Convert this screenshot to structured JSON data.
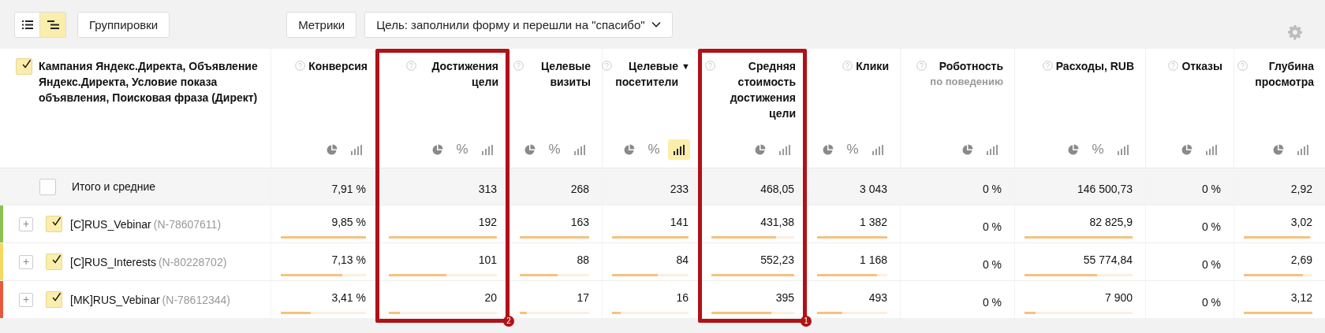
{
  "toolbar": {
    "view_toggle": [
      {
        "kind": "list",
        "selected": false
      },
      {
        "kind": "tree",
        "selected": true
      }
    ],
    "groupings_button": "Группировки",
    "metrics_button": "Метрики",
    "goal_dropdown": "Цель: заполнили форму и перешли на \"спасибо\""
  },
  "dimension_header": {
    "checked": true,
    "title": "Кампания Яндекс.Директа, Объявление Яндекс.Директа, Условие показа объявления, Поисковая фраза (Директ)"
  },
  "columns": [
    {
      "title": "Конверсия",
      "highlighted": false,
      "buttons": [
        {
          "kind": "pie",
          "selected": false
        },
        {
          "kind": "bars",
          "selected": false
        }
      ]
    },
    {
      "title": "Достижения цели",
      "highlighted": true,
      "badge": "2",
      "buttons": [
        {
          "kind": "pie",
          "selected": false
        },
        {
          "kind": "percent",
          "label": "%",
          "selected": false
        },
        {
          "kind": "bars",
          "selected": false
        }
      ]
    },
    {
      "title": "Целевые визиты",
      "highlighted": false,
      "buttons": [
        {
          "kind": "pie",
          "selected": false
        },
        {
          "kind": "percent",
          "label": "%",
          "selected": false
        },
        {
          "kind": "bars",
          "selected": false
        }
      ]
    },
    {
      "title": "Целевые посетители",
      "sort": "▼",
      "highlighted": false,
      "buttons": [
        {
          "kind": "pie",
          "selected": false
        },
        {
          "kind": "percent",
          "label": "%",
          "selected": false
        },
        {
          "kind": "bars",
          "selected": true
        }
      ]
    },
    {
      "title": "Средняя стоимость достижения цели",
      "highlighted": true,
      "badge": "1",
      "buttons": [
        {
          "kind": "pie",
          "selected": false
        },
        {
          "kind": "bars",
          "selected": false
        }
      ]
    },
    {
      "title": "Клики",
      "highlighted": false,
      "buttons": [
        {
          "kind": "pie",
          "selected": false
        },
        {
          "kind": "percent",
          "label": "%",
          "selected": false
        },
        {
          "kind": "bars",
          "selected": false
        }
      ]
    },
    {
      "title": "Роботность",
      "subtitle": "по поведению",
      "highlighted": false,
      "buttons": [
        {
          "kind": "pie",
          "selected": false
        },
        {
          "kind": "bars",
          "selected": false
        }
      ]
    },
    {
      "title": "Расходы, RUB",
      "highlighted": false,
      "buttons": [
        {
          "kind": "pie",
          "selected": false
        },
        {
          "kind": "percent",
          "label": "%",
          "selected": false
        },
        {
          "kind": "bars",
          "selected": false
        }
      ]
    },
    {
      "title": "Отказы",
      "highlighted": false,
      "buttons": [
        {
          "kind": "pie",
          "selected": false
        },
        {
          "kind": "bars",
          "selected": false
        }
      ]
    },
    {
      "title": "Глубина просмотра",
      "highlighted": false,
      "buttons": [
        {
          "kind": "pie",
          "selected": false
        },
        {
          "kind": "bars",
          "selected": false
        }
      ]
    }
  ],
  "rows": [
    {
      "kind": "total",
      "checked": false,
      "name": "Итого и средние",
      "cells": [
        {
          "value": "7,91 %"
        },
        {
          "value": "313"
        },
        {
          "value": "268"
        },
        {
          "value": "233"
        },
        {
          "value": "468,05"
        },
        {
          "value": "3 043"
        },
        {
          "value": "0 %"
        },
        {
          "value": "146 500,73"
        },
        {
          "value": "0 %"
        },
        {
          "value": "2,92"
        }
      ]
    },
    {
      "kind": "item",
      "color": "#8cc152",
      "expand": "+",
      "checked": true,
      "name": "[C]RUS_Vebinar",
      "id": "(N-78607611)",
      "cells": [
        {
          "value": "9,85 %",
          "level": 1
        },
        {
          "value": "192",
          "level": 1
        },
        {
          "value": "163",
          "level": 1
        },
        {
          "value": "141",
          "level": 1
        },
        {
          "value": "431,38",
          "level": 0.78
        },
        {
          "value": "1 382",
          "level": 1
        },
        {
          "value": "0 %"
        },
        {
          "value": "82 825,9",
          "level": 1
        },
        {
          "value": "0 %"
        },
        {
          "value": "3,02",
          "level": 0.97
        }
      ]
    },
    {
      "kind": "item",
      "color": "#f6d860",
      "expand": "+",
      "checked": true,
      "name": "[C]RUS_Interests",
      "id": "(N-80228702)",
      "cells": [
        {
          "value": "7,13 %",
          "level": 0.72
        },
        {
          "value": "101",
          "level": 0.53
        },
        {
          "value": "88",
          "level": 0.54
        },
        {
          "value": "84",
          "level": 0.6
        },
        {
          "value": "552,23",
          "level": 1
        },
        {
          "value": "1 168",
          "level": 0.85
        },
        {
          "value": "0 %"
        },
        {
          "value": "55 774,84",
          "level": 0.67
        },
        {
          "value": "0 %"
        },
        {
          "value": "2,69",
          "level": 0.86
        }
      ]
    },
    {
      "kind": "item",
      "color": "#e9573f",
      "expand": "+",
      "checked": true,
      "name": "[MK]RUS_Vebinar",
      "id": "(N-78612344)",
      "cells": [
        {
          "value": "3,41 %",
          "level": 0.35
        },
        {
          "value": "20",
          "level": 0.1
        },
        {
          "value": "17",
          "level": 0.1
        },
        {
          "value": "16",
          "level": 0.11
        },
        {
          "value": "395",
          "level": 0.72
        },
        {
          "value": "493",
          "level": 0.36
        },
        {
          "value": "0 %"
        },
        {
          "value": "7 900",
          "level": 0.1
        },
        {
          "value": "0 %"
        },
        {
          "value": "3,12",
          "level": 1
        }
      ]
    }
  ]
}
